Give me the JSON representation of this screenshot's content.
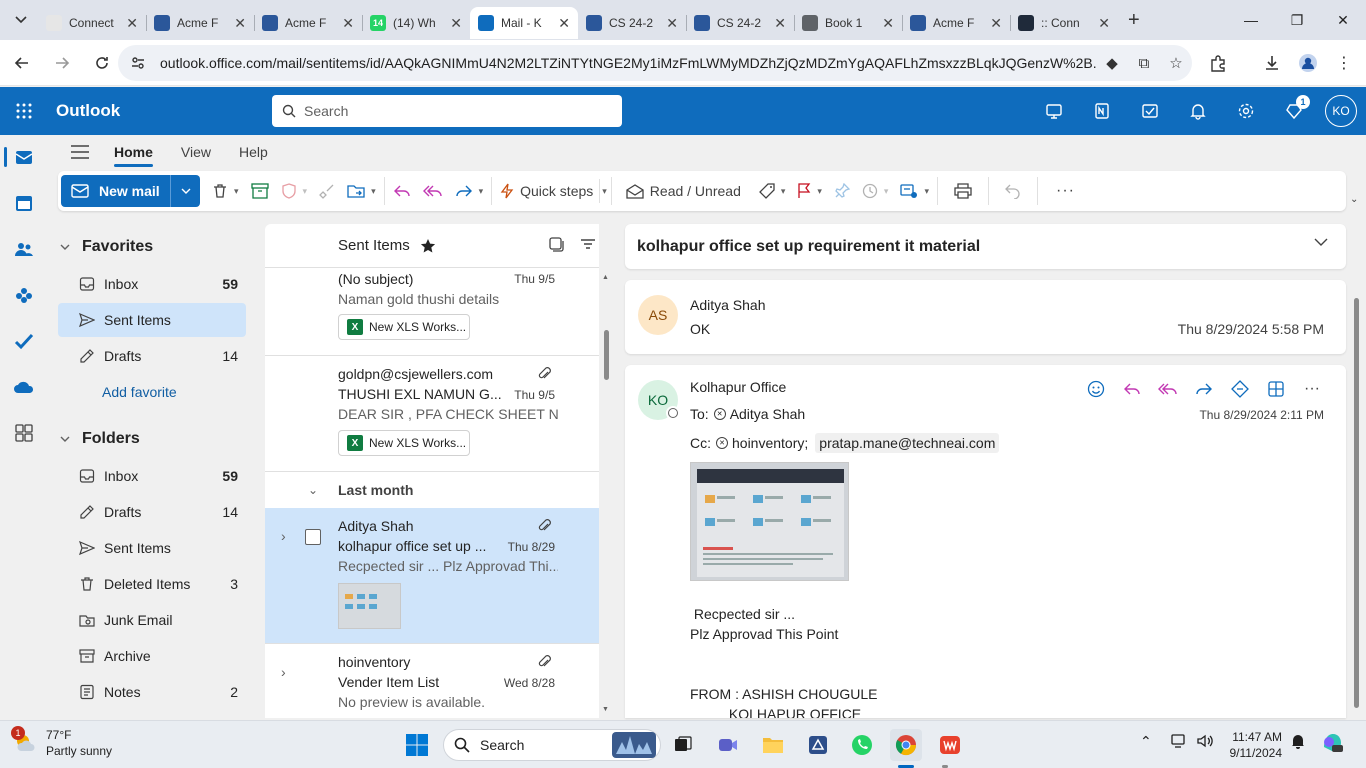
{
  "browser": {
    "tabs": [
      {
        "title": "Connect",
        "fav_color": "#e6e6e6",
        "fav_text": ""
      },
      {
        "title": "Acme F",
        "fav_color": "#2b579a",
        "fav_text": ""
      },
      {
        "title": "Acme F",
        "fav_color": "#2b579a",
        "fav_text": ""
      },
      {
        "title": "(14) Wh",
        "fav_color": "#25d366",
        "fav_text": "14"
      },
      {
        "title": "Mail - K",
        "fav_color": "#0f6cbd",
        "fav_text": ""
      },
      {
        "title": "CS 24-2",
        "fav_color": "#2b579a",
        "fav_text": ""
      },
      {
        "title": "CS 24-2",
        "fav_color": "#2b579a",
        "fav_text": ""
      },
      {
        "title": "Book 1",
        "fav_color": "#5f6368",
        "fav_text": ""
      },
      {
        "title": "Acme F",
        "fav_color": "#2b579a",
        "fav_text": ""
      },
      {
        "title": ":: Conn",
        "fav_color": "#1f2a3a",
        "fav_text": ""
      }
    ],
    "url": "outlook.office.com/mail/sentitems/id/AAQkAGNIMmU4N2M2LTZiNTYtNGE2My1iMzFmLWMyMDZhZjQzMDZmYgAQAFLhZmsxzzBLqkJQGenzW%2B..."
  },
  "outlook": {
    "brand": "Outlook",
    "search_placeholder": "Search",
    "avatar_initials": "KO",
    "premium_badge": "1",
    "accent": "#0f6cbd"
  },
  "ribbon": {
    "tabs": [
      "Home",
      "View",
      "Help"
    ],
    "new_mail": "New mail",
    "quick_steps": "Quick steps",
    "read_unread": "Read / Unread"
  },
  "folders": {
    "favorites_label": "Favorites",
    "favorites": [
      {
        "name": "Inbox",
        "count": "59",
        "bold": true,
        "icon": "inbox-icon"
      },
      {
        "name": "Sent Items",
        "count": "",
        "bold": false,
        "icon": "send-icon",
        "selected": true
      },
      {
        "name": "Drafts",
        "count": "14",
        "bold": false,
        "icon": "pencil-icon"
      }
    ],
    "add_favorite": "Add favorite",
    "folders_label": "Folders",
    "list": [
      {
        "name": "Inbox",
        "count": "59",
        "bold": true,
        "icon": "inbox-icon"
      },
      {
        "name": "Drafts",
        "count": "14",
        "bold": false,
        "icon": "pencil-icon"
      },
      {
        "name": "Sent Items",
        "count": "",
        "bold": false,
        "icon": "send-icon"
      },
      {
        "name": "Deleted Items",
        "count": "3",
        "bold": false,
        "icon": "trash-icon"
      },
      {
        "name": "Junk Email",
        "count": "",
        "bold": false,
        "icon": "junk-icon"
      },
      {
        "name": "Archive",
        "count": "",
        "bold": false,
        "icon": "archive-icon"
      },
      {
        "name": "Notes",
        "count": "2",
        "bold": false,
        "icon": "notes-icon"
      }
    ]
  },
  "message_list": {
    "title": "Sent Items",
    "group_label": "Last month",
    "items": [
      {
        "sender": "(No subject)",
        "subject": "",
        "date": "Thu 9/5",
        "preview": "Naman gold thushi details",
        "attachment": "New XLS Works..."
      },
      {
        "sender": "goldpn@csjewellers.com",
        "subject": "THUSHI EXL NAMUN G...",
        "date": "Thu 9/5",
        "preview": "DEAR SIR , PFA CHECK SHEET NO...",
        "attachment": "New XLS Works..."
      },
      {
        "sender": "Aditya Shah",
        "subject": "kolhapur office set up ...",
        "date": "Thu 8/29",
        "preview": "Recpected sir ... Plz Approvad Thi..."
      },
      {
        "sender": "hoinventory",
        "subject": "Vender Item List",
        "date": "Wed 8/28",
        "preview": "No preview is available."
      }
    ]
  },
  "reading": {
    "subject": "kolhapur office set up requirement it material",
    "msg1": {
      "initials": "AS",
      "sender": "Aditya Shah",
      "body": "OK",
      "date": "Thu 8/29/2024 5:58 PM",
      "persona_bg": "#fde7c7",
      "persona_fg": "#8a4b08"
    },
    "msg2": {
      "initials": "KO",
      "sender": "Kolhapur Office",
      "to_label": "To:",
      "to": "Aditya Shah",
      "cc_label": "Cc:",
      "cc1": "hoinventory;",
      "cc2": "pratap.mane@techneai.com",
      "date": "Thu 8/29/2024 2:11 PM",
      "persona_bg": "#d9f2e3",
      "persona_fg": "#0b6a3b",
      "body_lines": [
        " Recpected sir ...",
        "Plz Approvad This Point",
        "",
        "",
        "FROM : ASHISH CHOUGULE",
        "          KOLHAPUR OFFICE"
      ]
    }
  },
  "taskbar": {
    "weather_badge": "1",
    "temp": "77°F",
    "condition": "Partly sunny",
    "search": "Search",
    "time": "11:47 AM",
    "date": "9/11/2024"
  }
}
